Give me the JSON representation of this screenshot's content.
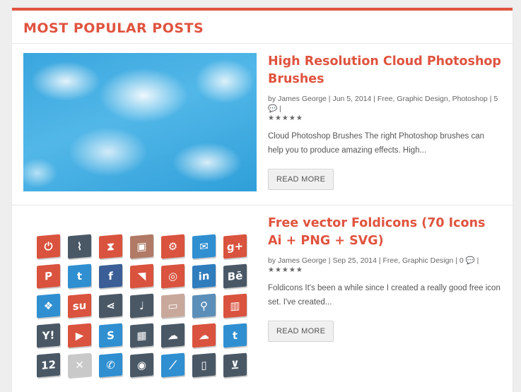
{
  "widget": {
    "title": "MOST POPULAR POSTS",
    "accent_color": "#e0533f"
  },
  "posts": [
    {
      "title": "High Resolution Cloud Photoshop Brushes",
      "meta": {
        "by": "by",
        "author": "James George",
        "date": "Jun 5, 2014",
        "categories": [
          "Free",
          "Graphic Design",
          "Photoshop"
        ],
        "comments": "5"
      },
      "rating": "★★★★★",
      "excerpt": "Cloud Photoshop Brushes The right Photoshop brushes can help you to produce amazing effects. High...",
      "read_more": "READ MORE",
      "thumbnail": "cloud-sky-image"
    },
    {
      "title": "Free vector Foldicons (70 Icons Ai + PNG + SVG)",
      "meta": {
        "by": "by",
        "author": "James George",
        "date": "Sep 25, 2014",
        "categories": [
          "Free",
          "Graphic Design"
        ],
        "comments": "0"
      },
      "rating": "★★★★★",
      "excerpt": "Foldicons It's been a while since I created a really good free icon set. I've created...",
      "read_more": "READ MORE",
      "thumbnail": "foldicons-grid-image",
      "icons": [
        {
          "name": "power-icon",
          "glyph": "⏻",
          "color": "#d9533e"
        },
        {
          "name": "paperclip-icon",
          "glyph": "⌇",
          "color": "#4a5866"
        },
        {
          "name": "hourglass-icon",
          "glyph": "⧗",
          "color": "#d9533e"
        },
        {
          "name": "briefcase-icon",
          "glyph": "▣",
          "color": "#b07a66"
        },
        {
          "name": "gear-icon",
          "glyph": "⚙",
          "color": "#d9533e"
        },
        {
          "name": "mail-icon",
          "glyph": "✉",
          "color": "#2f8fd1"
        },
        {
          "name": "google-plus-icon",
          "glyph": "g+",
          "color": "#d9533e"
        },
        {
          "name": "pinterest-icon",
          "glyph": "P",
          "color": "#d9533e"
        },
        {
          "name": "twitter-icon",
          "glyph": "t",
          "color": "#2f8fd1"
        },
        {
          "name": "facebook-icon",
          "glyph": "f",
          "color": "#3b5e96"
        },
        {
          "name": "rss-icon",
          "glyph": "◥",
          "color": "#d9533e"
        },
        {
          "name": "dribbble-icon",
          "glyph": "◎",
          "color": "#d9533e"
        },
        {
          "name": "linkedin-icon",
          "glyph": "in",
          "color": "#2f7dbd"
        },
        {
          "name": "behance-icon",
          "glyph": "Bē",
          "color": "#4a5866"
        },
        {
          "name": "dropbox-icon",
          "glyph": "❖",
          "color": "#2f8fd1"
        },
        {
          "name": "stumbleupon-icon",
          "glyph": "su",
          "color": "#d9533e"
        },
        {
          "name": "share-icon",
          "glyph": "⋖",
          "color": "#4a5866"
        },
        {
          "name": "microphone-icon",
          "glyph": "♩",
          "color": "#4a5866"
        },
        {
          "name": "folder-icon",
          "glyph": "▭",
          "color": "#c9a89c"
        },
        {
          "name": "search-icon",
          "glyph": "⚲",
          "color": "#5b8fb9"
        },
        {
          "name": "trash-icon",
          "glyph": "▥",
          "color": "#d9533e"
        },
        {
          "name": "yahoo-icon",
          "glyph": "Y!",
          "color": "#4a5866"
        },
        {
          "name": "youtube-icon",
          "glyph": "▶",
          "color": "#d9533e"
        },
        {
          "name": "skype-icon",
          "glyph": "S",
          "color": "#2f8fd1"
        },
        {
          "name": "film-icon",
          "glyph": "▦",
          "color": "#4a5866"
        },
        {
          "name": "cloud-upload-icon",
          "glyph": "☁",
          "color": "#4a5866"
        },
        {
          "name": "cloud-download-icon",
          "glyph": "☁",
          "color": "#d9533e"
        },
        {
          "name": "twitter-bird-icon",
          "glyph": "t",
          "color": "#2f8fd1"
        },
        {
          "name": "calendar-icon",
          "glyph": "12",
          "color": "#4a5866"
        },
        {
          "name": "tools-icon",
          "glyph": "✕",
          "color": "#c9c9c9"
        },
        {
          "name": "phone-icon",
          "glyph": "✆",
          "color": "#2f8fd1"
        },
        {
          "name": "camera-icon",
          "glyph": "◉",
          "color": "#4a5866"
        },
        {
          "name": "chart-icon",
          "glyph": "⟋",
          "color": "#2f8fd1"
        },
        {
          "name": "mobile-icon",
          "glyph": "▯",
          "color": "#4a5866"
        },
        {
          "name": "cart-icon",
          "glyph": "⊻",
          "color": "#4a5866"
        }
      ]
    }
  ]
}
